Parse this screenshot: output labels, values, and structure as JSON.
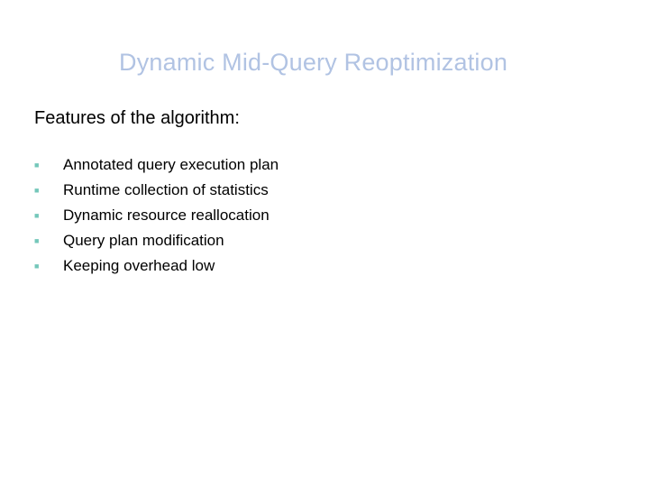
{
  "slide": {
    "title": "Dynamic Mid-Query Reoptimization",
    "subtitle": "Features of the algorithm:",
    "bullets": [
      "Annotated query execution plan",
      "Runtime collection of statistics",
      "Dynamic resource reallocation",
      "Query plan modification",
      "Keeping overhead low"
    ]
  }
}
